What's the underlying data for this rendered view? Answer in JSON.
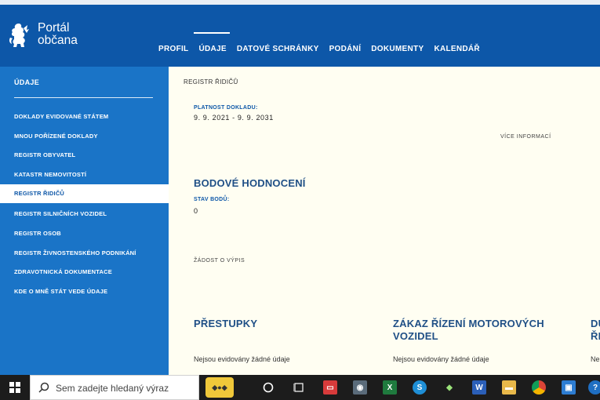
{
  "header": {
    "logo_line1": "Portál",
    "logo_line2": "občana",
    "nav": [
      "PROFIL",
      "ÚDAJE",
      "DATOVÉ SCHRÁNKY",
      "PODÁNÍ",
      "DOKUMENTY",
      "KALENDÁŘ"
    ],
    "nav_active": "ÚDAJE"
  },
  "sidebar": {
    "title": "ÚDAJE",
    "items": [
      "DOKLADY EVIDOVANÉ STÁTEM",
      "MNOU POŘÍZENÉ DOKLADY",
      "REGISTR OBYVATEL",
      "KATASTR NEMOVITOSTÍ",
      "REGISTR ŘIDIČŮ",
      "REGISTR SILNIČNÍCH VOZIDEL",
      "REGISTR OSOB",
      "REGISTR ŽIVNOSTENSKÉHO PODNIKÁNÍ",
      "ZDRAVOTNICKÁ DOKUMENTACE",
      "KDE O MNĚ STÁT VEDE ÚDAJE"
    ],
    "active": "REGISTR ŘIDIČŮ"
  },
  "main": {
    "breadcrumb": "REGISTR ŘIDIČŮ",
    "validity_label": "PLATNOST DOKLADU:",
    "validity_value": "9. 9. 2021  -  9. 9. 2031",
    "more_info": "VÍCE INFORMACÍ",
    "points_heading": "BODOVÉ HODNOCENÍ",
    "points_label": "STAV BODŮ:",
    "points_value": "0",
    "extract_request": "ŽÁDOST O VÝPIS",
    "offenses_heading": "PŘESTUPKY",
    "offenses_text": "Nejsou evidovány žádné údaje",
    "ban_heading_line1": "ZÁKAZ ŘÍZENÍ MOTOROVÝCH",
    "ban_heading_line2": "VOZIDEL",
    "ban_text": "Nejsou evidovány žádné údaje",
    "third_heading_line1": "DU",
    "third_heading_line2": "ŘI",
    "third_text": "Ne"
  },
  "taskbar": {
    "search_placeholder": "Sem zadejte hledaný výraz",
    "colors": {
      "bar": "#1c1c1c",
      "accent": "#0d57a8"
    }
  }
}
